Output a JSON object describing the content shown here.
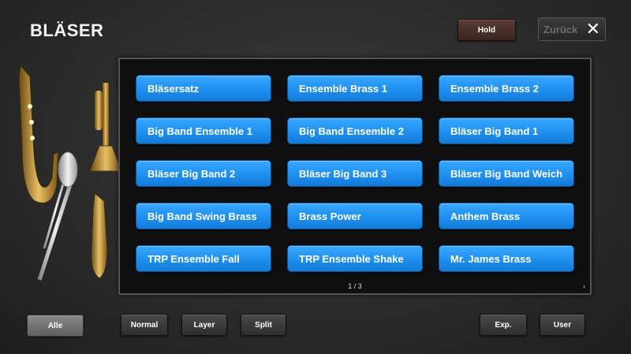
{
  "header": {
    "title": "BLÄSER",
    "hold_label": "Hold",
    "back_label": "Zurück",
    "close_icon": "✕"
  },
  "sounds": [
    "Bläsersatz",
    "Ensemble Brass 1",
    "Ensemble Brass 2",
    "Big Band Ensemble 1",
    "Big Band Ensemble 2",
    "Bläser Big Band 1",
    "Bläser Big Band 2",
    "Bläser Big Band 3",
    "Bläser Big Band Weich",
    "Big Band Swing Brass",
    "Brass Power",
    "Anthem Brass",
    "TRP Ensemble Fall",
    "TRP Ensemble Shake",
    "Mr. James Brass"
  ],
  "pager": {
    "text": "1 / 3",
    "next_icon": "chevron-right-icon"
  },
  "footer": {
    "alle": "Alle",
    "normal": "Normal",
    "layer": "Layer",
    "split": "Split",
    "exp": "Exp.",
    "user": "User"
  },
  "colors": {
    "sound_button": "#1f8ff0",
    "background": "#2a2a2a",
    "hold": "#4a2f29"
  },
  "decor": {
    "instruments": [
      "saxophone-image",
      "trumpet-image",
      "trombone-image",
      "saxophone-image"
    ]
  }
}
